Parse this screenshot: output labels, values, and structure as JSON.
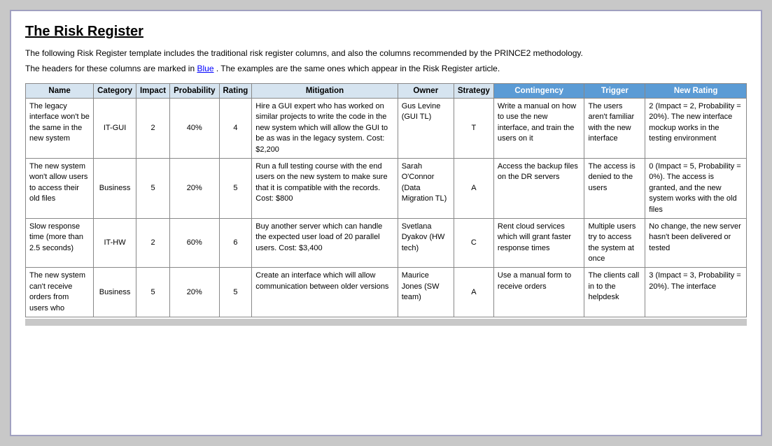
{
  "page": {
    "title": "The Risk Register",
    "description1": "The following Risk Register template includes the traditional risk register columns, and also the columns recommended by the PRINCE2 methodology.",
    "description2": "The headers for these columns are marked in",
    "description2_blue": "Blue",
    "description2_end": ". The examples are the same ones which appear in the Risk Register article."
  },
  "table": {
    "headers": [
      {
        "label": "Name",
        "blue": false
      },
      {
        "label": "Category",
        "blue": false
      },
      {
        "label": "Impact",
        "blue": false
      },
      {
        "label": "Probability",
        "blue": false
      },
      {
        "label": "Rating",
        "blue": false
      },
      {
        "label": "Mitigation",
        "blue": false
      },
      {
        "label": "Owner",
        "blue": false
      },
      {
        "label": "Strategy",
        "blue": false
      },
      {
        "label": "Contingency",
        "blue": true
      },
      {
        "label": "Trigger",
        "blue": true
      },
      {
        "label": "New Rating",
        "blue": true
      }
    ],
    "rows": [
      {
        "name": "The legacy interface won't be the same in the new system",
        "category": "IT-GUI",
        "impact": "2",
        "probability": "40%",
        "rating": "4",
        "mitigation": "Hire a GUI expert who has worked on similar projects to write the code in the new system which will allow the GUI to be as was in the legacy system. Cost: $2,200",
        "owner": "Gus Levine (GUI TL)",
        "strategy": "T",
        "contingency": "Write a manual on how to use the new interface, and train the users on it",
        "trigger": "The users aren't familiar with the new interface",
        "new_rating": "2 (Impact = 2, Probability = 20%). The new interface mockup works in the testing environment"
      },
      {
        "name": "The new system won't allow users to access their old files",
        "category": "Business",
        "impact": "5",
        "probability": "20%",
        "rating": "5",
        "mitigation": "Run a full testing course with the end users on the new system to make sure that it is compatible with the records. Cost: $800",
        "owner": "Sarah O'Connor (Data Migration TL)",
        "strategy": "A",
        "contingency": "Access the backup files on the DR servers",
        "trigger": "The access is denied to the users",
        "new_rating": "0 (Impact = 5, Probability = 0%). The access is granted, and the new system works with the old files"
      },
      {
        "name": "Slow response time (more than 2.5 seconds)",
        "category": "IT-HW",
        "impact": "2",
        "probability": "60%",
        "rating": "6",
        "mitigation": "Buy another server which can handle the expected user load of 20 parallel users. Cost: $3,400",
        "owner": "Svetlana Dyakov (HW tech)",
        "strategy": "C",
        "contingency": "Rent cloud services which will grant faster response times",
        "trigger": "Multiple users try to access the system at once",
        "new_rating": "No change, the new server hasn't been delivered or tested"
      },
      {
        "name": "The new system can't receive orders from users who",
        "category": "Business",
        "impact": "5",
        "probability": "20%",
        "rating": "5",
        "mitigation": "Create an interface which will allow communication between older versions",
        "owner": "Maurice Jones (SW team)",
        "strategy": "A",
        "contingency": "Use a manual form to receive orders",
        "trigger": "The clients call in to the helpdesk",
        "new_rating": "3 (Impact = 3, Probability = 20%). The interface"
      }
    ]
  }
}
